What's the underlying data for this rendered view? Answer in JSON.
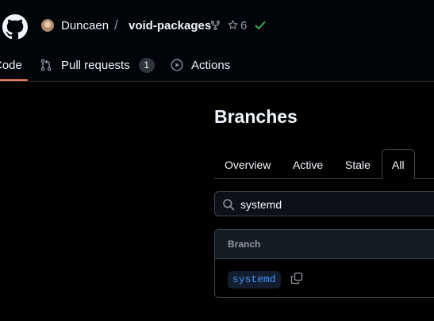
{
  "header": {
    "owner": "Duncaen",
    "separator": "/",
    "repo": "void-packages",
    "star_count": "6"
  },
  "nav": {
    "code_label": "Code",
    "pull_requests_label": "Pull requests",
    "pull_requests_count": "1",
    "actions_label": "Actions"
  },
  "page": {
    "title": "Branches"
  },
  "tabs": {
    "overview": "Overview",
    "active": "Active",
    "stale": "Stale",
    "all": "All",
    "selected": "All"
  },
  "search": {
    "value": "systemd"
  },
  "table": {
    "header": "Branch",
    "rows": [
      {
        "name": "systemd"
      }
    ]
  },
  "icons": {
    "logo": "github-mark-icon",
    "fork": "repo-forked-icon",
    "star": "star-icon",
    "status": "check-icon",
    "pull_requests": "git-pull-request-icon",
    "actions": "play-icon",
    "search": "search-icon",
    "copy": "copy-icon"
  },
  "colors": {
    "background": "#000000",
    "accent_underline": "#f78166",
    "success": "#3fb950",
    "branch_link": "#4493f8",
    "muted_text": "#9198a1",
    "border": "#3d444d"
  }
}
